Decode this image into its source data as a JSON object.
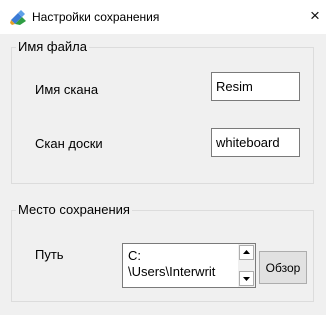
{
  "window": {
    "title": "Настройки сохранения",
    "close_glyph": "×"
  },
  "filename_group": {
    "label": "Имя файла",
    "scan_name_label": "Имя скана",
    "scan_name_value": "Resim",
    "board_scan_label": "Скан доски",
    "board_scan_value": "whiteboard"
  },
  "location_group": {
    "label": "Место сохранения",
    "path_label": "Путь",
    "path_value": "C:\n\\Users\\Interwrit",
    "browse_label": "Обзор"
  },
  "icons": {
    "app": "app-icon",
    "close": "close-icon",
    "scroll_up": "arrow-up-icon",
    "scroll_down": "arrow-down-icon"
  },
  "colors": {
    "dialog_bg": "#f0f0f0",
    "titlebar_bg": "#ffffff",
    "group_border": "#dcdcdc",
    "input_border": "#7a7a7a",
    "button_bg": "#e1e1e1"
  }
}
